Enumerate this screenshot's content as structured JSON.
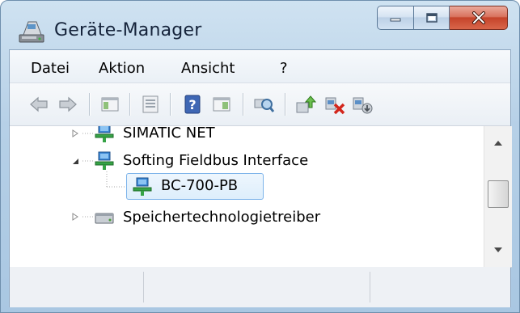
{
  "window": {
    "title": "Geräte-Manager",
    "icon": "device-manager-icon",
    "caption_buttons": [
      "minimize-icon",
      "maximize-icon",
      "close-icon"
    ]
  },
  "menu": {
    "items": [
      {
        "label": "Datei"
      },
      {
        "label": "Aktion"
      },
      {
        "label": "Ansicht"
      },
      {
        "label": "?"
      }
    ]
  },
  "toolbar": {
    "buttons": [
      "back-icon",
      "forward-icon",
      "show-hide-console-tree-icon",
      "properties-icon",
      "help-icon",
      "action-pane-icon",
      "scan-hardware-icon",
      "update-driver-icon",
      "uninstall-icon",
      "disable-device-icon"
    ]
  },
  "tree": {
    "nodes": [
      {
        "label": "SIMATIC NET",
        "state": "collapsed",
        "icon": "network-device-icon"
      },
      {
        "label": "Softing Fieldbus Interface",
        "state": "expanded",
        "icon": "network-device-icon"
      },
      {
        "label": "BC-700-PB",
        "state": "selected",
        "icon": "network-device-icon"
      },
      {
        "label": "Speichertechnologietreiber",
        "state": "collapsed",
        "icon": "storage-icon"
      }
    ]
  },
  "colors": {
    "frame": "#b6d0e7",
    "close_button": "#c5432a",
    "selection": "#ddeefc",
    "selection_border": "#7eb4ea"
  }
}
